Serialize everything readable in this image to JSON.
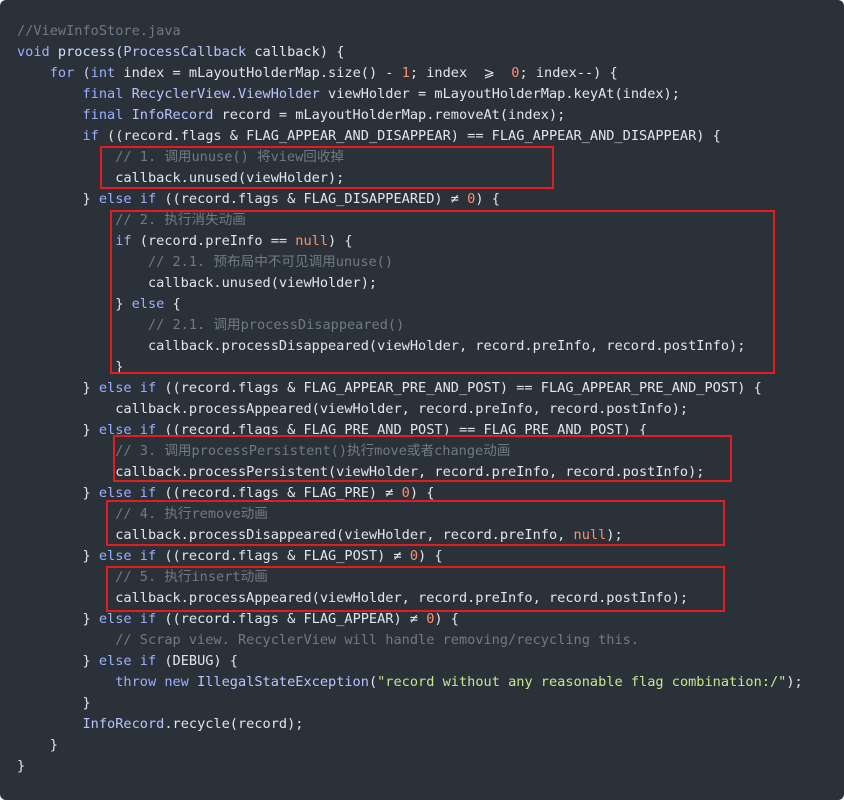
{
  "code": {
    "lines": [
      [
        {
          "t": "//ViewInfoStore.java",
          "c": "comment"
        }
      ],
      [
        {
          "t": "void ",
          "c": "keyword"
        },
        {
          "t": "process(",
          "c": "func"
        },
        {
          "t": "ProcessCallback",
          "c": "type"
        },
        {
          "t": " callback) {",
          "c": "ident"
        }
      ],
      [
        {
          "t": "    for ",
          "c": "keyword"
        },
        {
          "t": "(",
          "c": "op"
        },
        {
          "t": "int",
          "c": "keyword"
        },
        {
          "t": " index = mLayoutHolderMap.size() - ",
          "c": "ident"
        },
        {
          "t": "1",
          "c": "num"
        },
        {
          "t": "; index  ⩾  ",
          "c": "ident"
        },
        {
          "t": "0",
          "c": "num"
        },
        {
          "t": "; index--) {",
          "c": "ident"
        }
      ],
      [
        {
          "t": "        final ",
          "c": "keyword"
        },
        {
          "t": "RecyclerView.ViewHolder",
          "c": "type"
        },
        {
          "t": " viewHolder = mLayoutHolderMap.keyAt(index);",
          "c": "ident"
        }
      ],
      [
        {
          "t": "        final ",
          "c": "keyword"
        },
        {
          "t": "InfoRecord",
          "c": "type"
        },
        {
          "t": " record = mLayoutHolderMap.removeAt(index);",
          "c": "ident"
        }
      ],
      [
        {
          "t": "        if ",
          "c": "keyword"
        },
        {
          "t": "((record.flags & FLAG_APPEAR_AND_DISAPPEAR) == FLAG_APPEAR_AND_DISAPPEAR) {",
          "c": "ident"
        }
      ],
      [
        {
          "t": "            // 1. 调用unuse() 将view回收掉",
          "c": "comment"
        }
      ],
      [
        {
          "t": "            callback.unused(viewHolder);",
          "c": "ident"
        }
      ],
      [
        {
          "t": "        } ",
          "c": "ident"
        },
        {
          "t": "else if ",
          "c": "keyword"
        },
        {
          "t": "((record.flags & FLAG_DISAPPEARED) ≠ ",
          "c": "ident"
        },
        {
          "t": "0",
          "c": "num"
        },
        {
          "t": ") {",
          "c": "ident"
        }
      ],
      [
        {
          "t": "            // 2. 执行消失动画",
          "c": "comment"
        }
      ],
      [
        {
          "t": "            if ",
          "c": "keyword"
        },
        {
          "t": "(record.preInfo == ",
          "c": "ident"
        },
        {
          "t": "null",
          "c": "null"
        },
        {
          "t": ") {",
          "c": "ident"
        }
      ],
      [
        {
          "t": "                // 2.1. 预布局中不可见调用unuse()",
          "c": "comment"
        }
      ],
      [
        {
          "t": "                callback.unused(viewHolder);",
          "c": "ident"
        }
      ],
      [
        {
          "t": "            } ",
          "c": "ident"
        },
        {
          "t": "else ",
          "c": "keyword"
        },
        {
          "t": "{",
          "c": "ident"
        }
      ],
      [
        {
          "t": "                // 2.1. 调用processDisappeared()",
          "c": "comment"
        }
      ],
      [
        {
          "t": "                callback.processDisappeared(viewHolder, record.preInfo, record.postInfo);",
          "c": "ident"
        }
      ],
      [
        {
          "t": "            }",
          "c": "ident"
        }
      ],
      [
        {
          "t": "        } ",
          "c": "ident"
        },
        {
          "t": "else if ",
          "c": "keyword"
        },
        {
          "t": "((record.flags & FLAG_APPEAR_PRE_AND_POST) == FLAG_APPEAR_PRE_AND_POST) {",
          "c": "ident"
        }
      ],
      [
        {
          "t": "            callback.processAppeared(viewHolder, record.preInfo, record.postInfo);",
          "c": "ident"
        }
      ],
      [
        {
          "t": "        } ",
          "c": "ident"
        },
        {
          "t": "else if ",
          "c": "keyword"
        },
        {
          "t": "((record.flags & FLAG_PRE_AND_POST) == FLAG_PRE_AND_POST) {",
          "c": "ident"
        }
      ],
      [
        {
          "t": "            // 3. 调用processPersistent()执行move或者change动画",
          "c": "comment"
        }
      ],
      [
        {
          "t": "            callback.processPersistent(viewHolder, record.preInfo, record.postInfo);",
          "c": "ident"
        }
      ],
      [
        {
          "t": "        } ",
          "c": "ident"
        },
        {
          "t": "else if ",
          "c": "keyword"
        },
        {
          "t": "((record.flags & FLAG_PRE) ≠ ",
          "c": "ident"
        },
        {
          "t": "0",
          "c": "num"
        },
        {
          "t": ") {",
          "c": "ident"
        }
      ],
      [
        {
          "t": "            // 4. 执行remove动画",
          "c": "comment"
        }
      ],
      [
        {
          "t": "            callback.processDisappeared(viewHolder, record.preInfo, ",
          "c": "ident"
        },
        {
          "t": "null",
          "c": "null"
        },
        {
          "t": ");",
          "c": "ident"
        }
      ],
      [
        {
          "t": "        } ",
          "c": "ident"
        },
        {
          "t": "else if ",
          "c": "keyword"
        },
        {
          "t": "((record.flags & FLAG_POST) ≠ ",
          "c": "ident"
        },
        {
          "t": "0",
          "c": "num"
        },
        {
          "t": ") {",
          "c": "ident"
        }
      ],
      [
        {
          "t": "            // 5. 执行insert动画",
          "c": "comment"
        }
      ],
      [
        {
          "t": "            callback.processAppeared(viewHolder, record.preInfo, record.postInfo);",
          "c": "ident"
        }
      ],
      [
        {
          "t": "        } ",
          "c": "ident"
        },
        {
          "t": "else if ",
          "c": "keyword"
        },
        {
          "t": "((record.flags & FLAG_APPEAR) ≠ ",
          "c": "ident"
        },
        {
          "t": "0",
          "c": "num"
        },
        {
          "t": ") {",
          "c": "ident"
        }
      ],
      [
        {
          "t": "            // Scrap view. RecyclerView will handle removing/recycling this.",
          "c": "comment"
        }
      ],
      [
        {
          "t": "        } ",
          "c": "ident"
        },
        {
          "t": "else if ",
          "c": "keyword"
        },
        {
          "t": "(DEBUG) {",
          "c": "ident"
        }
      ],
      [
        {
          "t": "            throw new ",
          "c": "keyword"
        },
        {
          "t": "IllegalStateException",
          "c": "type"
        },
        {
          "t": "(",
          "c": "ident"
        },
        {
          "t": "\"record without any reasonable flag combination:/\"",
          "c": "string"
        },
        {
          "t": ");",
          "c": "ident"
        }
      ],
      [
        {
          "t": "        }",
          "c": "ident"
        }
      ],
      [
        {
          "t": "        InfoRecord",
          "c": "type"
        },
        {
          "t": ".recycle(record);",
          "c": "ident"
        }
      ],
      [
        {
          "t": "    }",
          "c": "ident"
        }
      ],
      [
        {
          "t": "}",
          "c": "ident"
        }
      ]
    ]
  },
  "colors": {
    "background": "#2b3138",
    "highlight_border": "#e11d1d"
  }
}
